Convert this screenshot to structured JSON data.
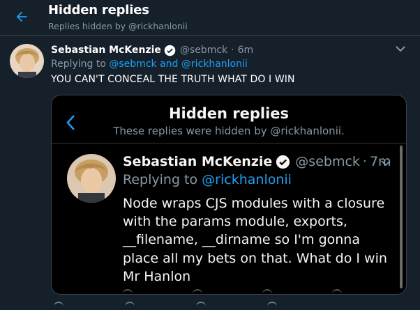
{
  "header": {
    "title": "Hidden replies",
    "subtitle": "Replies hidden by @rickhanlonii"
  },
  "tweet": {
    "name": "Sebastian McKenzie",
    "handle": "@sebmck",
    "separator": "·",
    "time": "6m",
    "replying_prefix": "Replying to",
    "replying_links": "@sebmck and @rickhanlonii",
    "text": "YOU CAN'T CONCEAL THE TRUTH WHAT DO I WIN"
  },
  "embed": {
    "title": "Hidden replies",
    "subtitle": "These replies were hidden by @rickhanlonii.",
    "name": "Sebastian McKenzie",
    "handle": "@sebmck",
    "separator": "·",
    "time": "7m",
    "replying_prefix": "Replying to",
    "replying_link": "@rickhanlonii",
    "text": "Node wraps CJS modules with a closure with the params module, exports, __filename, __dirname so I'm gonna place all my bets on that. What do I win Mr Hanlon"
  },
  "colors": {
    "background": "#15202b",
    "accent": "#1da1f2",
    "muted": "#8899a6",
    "embed_background": "#000000"
  },
  "icons": {
    "back": "arrow-left-icon",
    "verified": "verified-badge-icon",
    "more": "chevron-down-icon"
  }
}
